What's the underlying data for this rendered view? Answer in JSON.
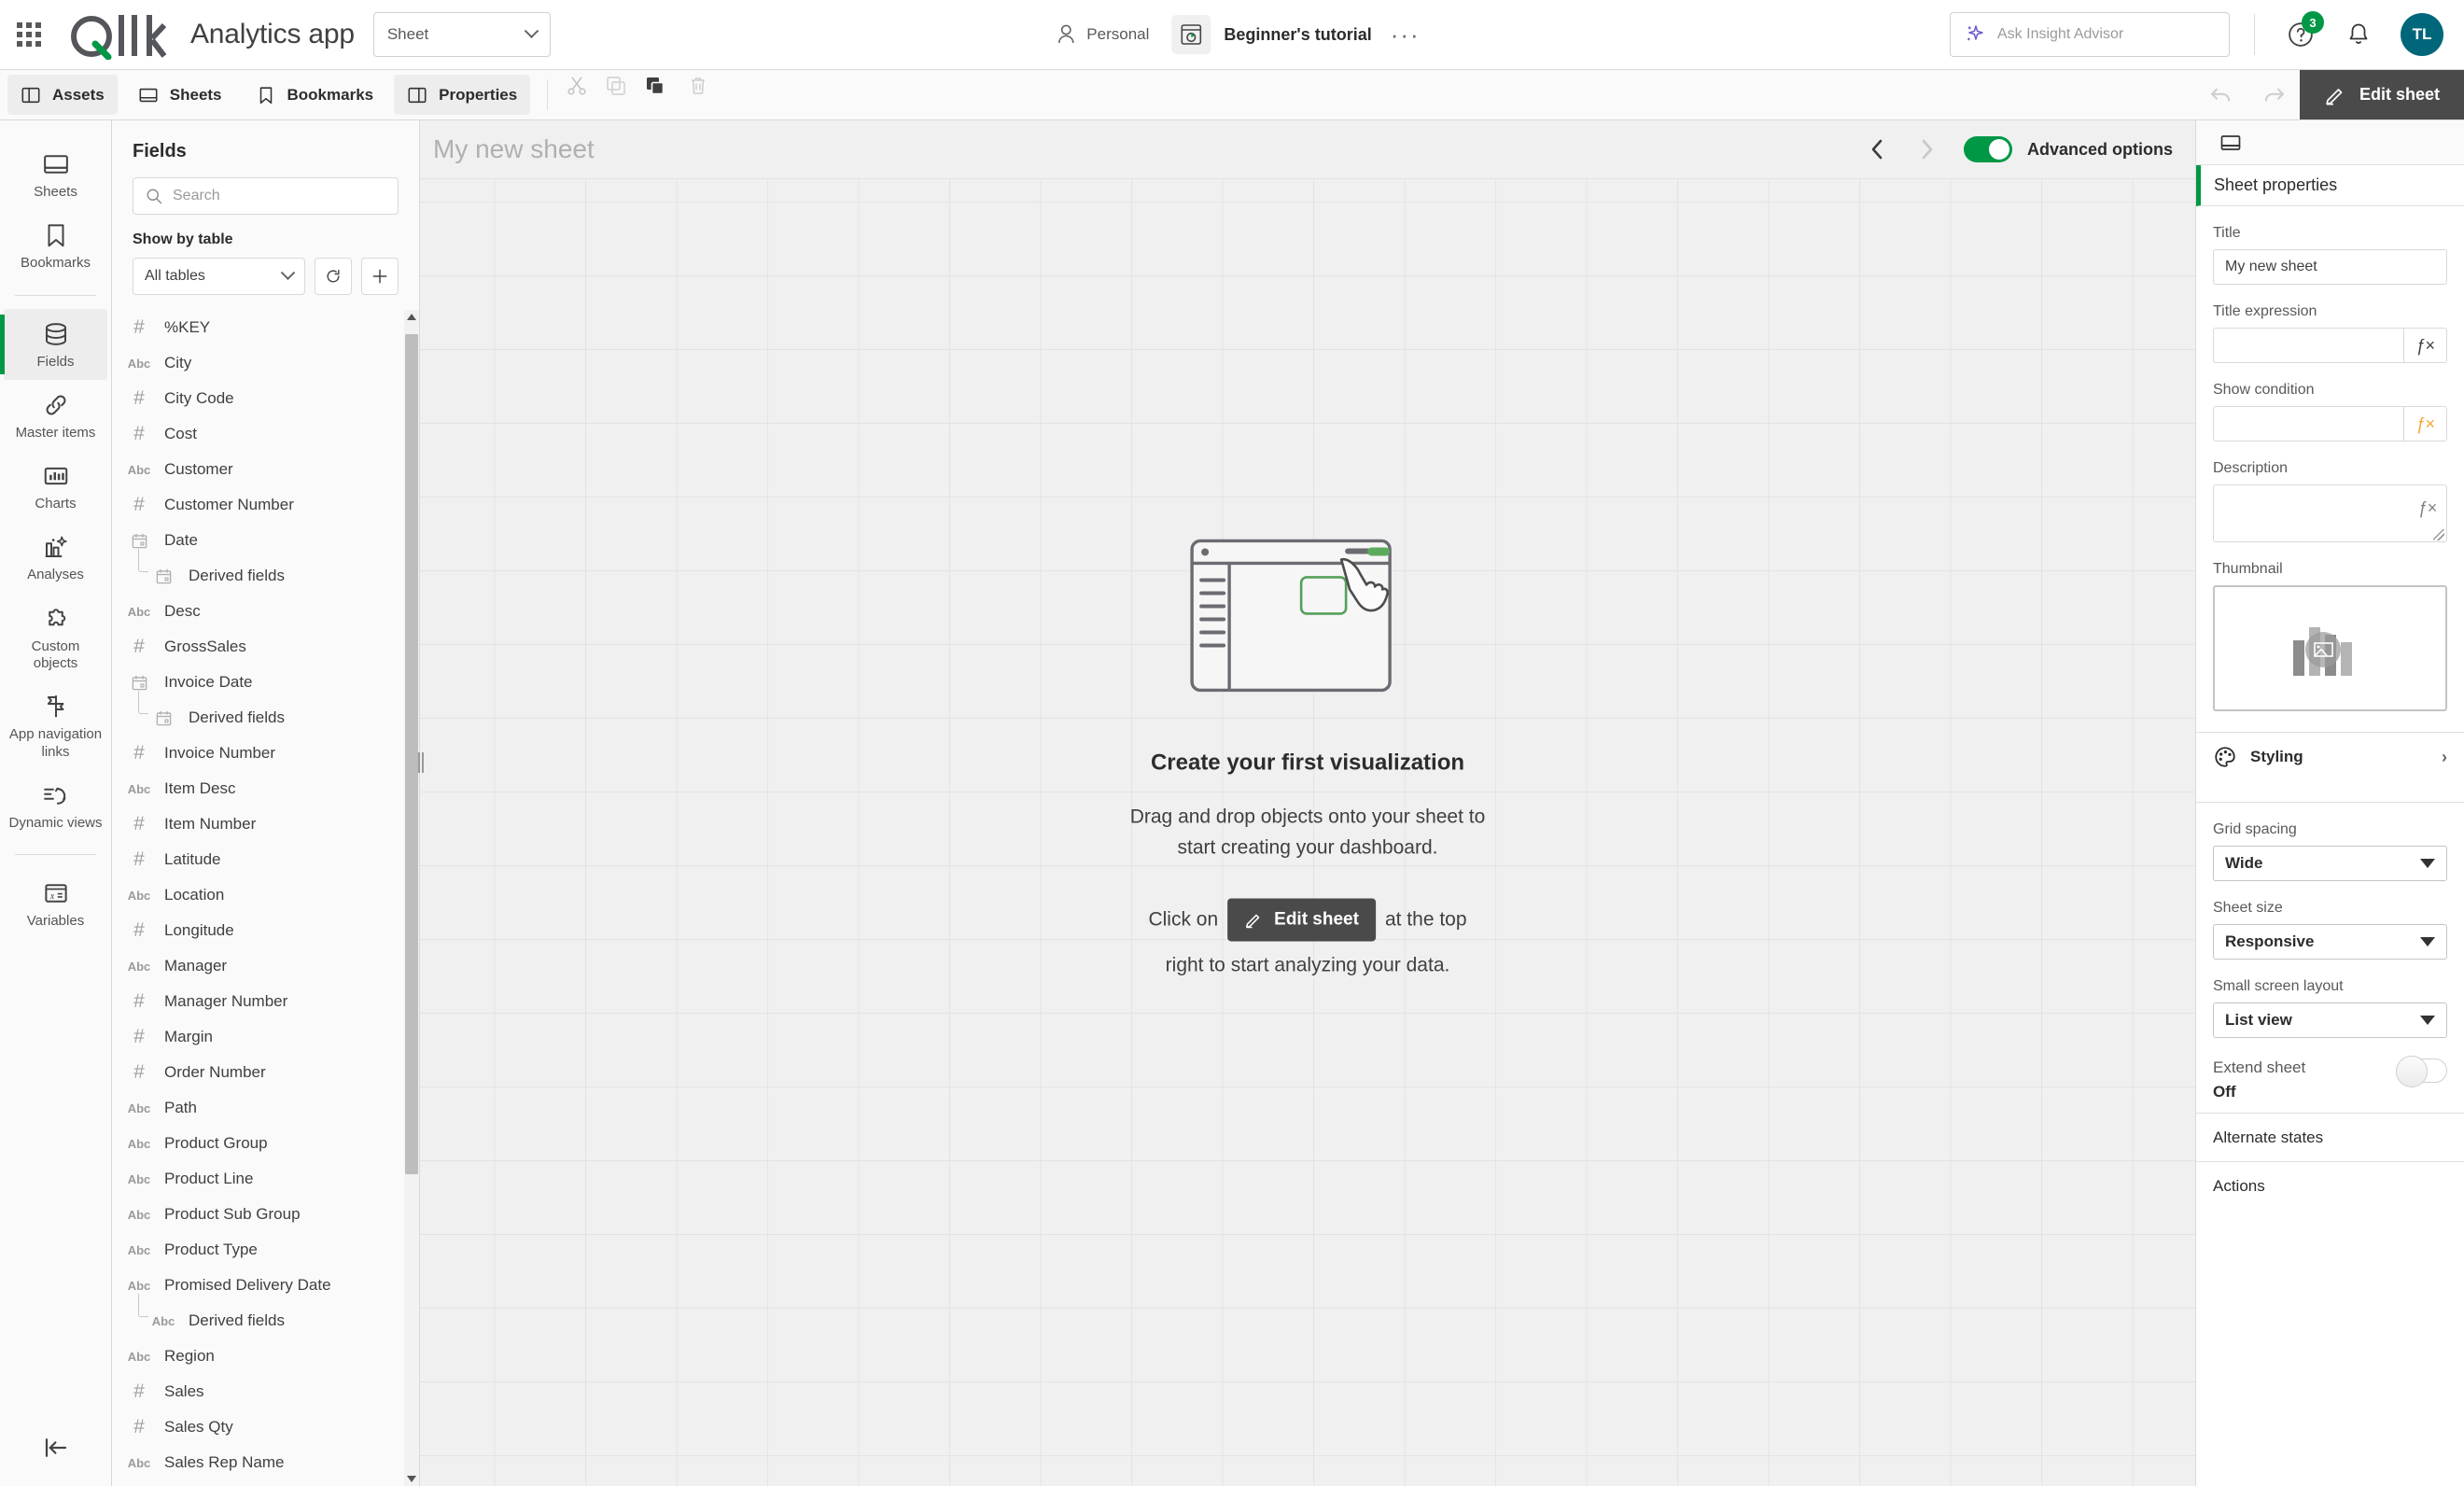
{
  "header": {
    "brand": "Qlik",
    "app_title": "Analytics app",
    "sheet_selector": "Sheet",
    "space_label": "Personal",
    "app_name": "Beginner's tutorial",
    "more_dots": "···",
    "insight_placeholder": "Ask Insight Advisor",
    "help_badge": "3",
    "avatar_initials": "TL"
  },
  "toolbar": {
    "assets": "Assets",
    "sheets": "Sheets",
    "bookmarks": "Bookmarks",
    "properties": "Properties",
    "edit_sheet": "Edit sheet"
  },
  "rail": {
    "items": [
      {
        "label": "Sheets",
        "icon": "sheet-icon",
        "active": false
      },
      {
        "label": "Bookmarks",
        "icon": "bookmark-icon",
        "active": false
      },
      {
        "label": "Fields",
        "icon": "database-icon",
        "active": true
      },
      {
        "label": "Master items",
        "icon": "link-icon",
        "active": false
      },
      {
        "label": "Charts",
        "icon": "bar-chart-icon",
        "active": false
      },
      {
        "label": "Analyses",
        "icon": "analyses-icon",
        "active": false
      },
      {
        "label": "Custom objects",
        "icon": "puzzle-icon",
        "active": false
      },
      {
        "label": "App navigation links",
        "icon": "flag-icon",
        "active": false
      },
      {
        "label": "Dynamic views",
        "icon": "dynamic-views-icon",
        "active": false
      },
      {
        "label": "Variables",
        "icon": "variable-icon",
        "active": false
      }
    ],
    "collapse_icon": "collapse-panel-icon"
  },
  "fields_panel": {
    "title": "Fields",
    "search_placeholder": "Search",
    "show_by_table_label": "Show by table",
    "table_filter_value": "All tables",
    "refresh_icon": "refresh-icon",
    "add_icon": "plus-icon",
    "items": [
      {
        "name": "%KEY",
        "type": "#",
        "child": false
      },
      {
        "name": "City",
        "type": "Abc",
        "child": false
      },
      {
        "name": "City Code",
        "type": "#",
        "child": false
      },
      {
        "name": "Cost",
        "type": "#",
        "child": false
      },
      {
        "name": "Customer",
        "type": "Abc",
        "child": false
      },
      {
        "name": "Customer Number",
        "type": "#",
        "child": false
      },
      {
        "name": "Date",
        "type": "cal",
        "child": false
      },
      {
        "name": "Derived fields",
        "type": "cal",
        "child": true
      },
      {
        "name": "Desc",
        "type": "Abc",
        "child": false
      },
      {
        "name": "GrossSales",
        "type": "#",
        "child": false
      },
      {
        "name": "Invoice Date",
        "type": "cal",
        "child": false
      },
      {
        "name": "Derived fields",
        "type": "cal",
        "child": true
      },
      {
        "name": "Invoice Number",
        "type": "#",
        "child": false
      },
      {
        "name": "Item Desc",
        "type": "Abc",
        "child": false
      },
      {
        "name": "Item Number",
        "type": "#",
        "child": false
      },
      {
        "name": "Latitude",
        "type": "#",
        "child": false
      },
      {
        "name": "Location",
        "type": "Abc",
        "child": false
      },
      {
        "name": "Longitude",
        "type": "#",
        "child": false
      },
      {
        "name": "Manager",
        "type": "Abc",
        "child": false
      },
      {
        "name": "Manager Number",
        "type": "#",
        "child": false
      },
      {
        "name": "Margin",
        "type": "#",
        "child": false
      },
      {
        "name": "Order Number",
        "type": "#",
        "child": false
      },
      {
        "name": "Path",
        "type": "Abc",
        "child": false
      },
      {
        "name": "Product Group",
        "type": "Abc",
        "child": false
      },
      {
        "name": "Product Line",
        "type": "Abc",
        "child": false
      },
      {
        "name": "Product Sub Group",
        "type": "Abc",
        "child": false
      },
      {
        "name": "Product Type",
        "type": "Abc",
        "child": false
      },
      {
        "name": "Promised Delivery Date",
        "type": "Abc",
        "child": false
      },
      {
        "name": "Derived fields",
        "type": "Abc",
        "child": true
      },
      {
        "name": "Region",
        "type": "Abc",
        "child": false
      },
      {
        "name": "Sales",
        "type": "#",
        "child": false
      },
      {
        "name": "Sales Qty",
        "type": "#",
        "child": false
      },
      {
        "name": "Sales Rep Name",
        "type": "Abc",
        "child": false
      }
    ]
  },
  "sheet": {
    "name": "My new sheet",
    "advanced_options_label": "Advanced options",
    "advanced_options_on": true,
    "empty_state": {
      "title": "Create your first visualization",
      "line1": "Drag and drop objects onto your sheet to",
      "line2": "start creating your dashboard.",
      "cta_prefix": "Click on",
      "cta_button": "Edit sheet",
      "cta_suffix": "at the top",
      "cta_line2": "right to start analyzing your data."
    }
  },
  "properties": {
    "tab_icon": "sheet-icon",
    "header": "Sheet properties",
    "title_label": "Title",
    "title_value": "My new sheet",
    "title_expression_label": "Title expression",
    "title_expression_value": "",
    "show_condition_label": "Show condition",
    "show_condition_value": "",
    "description_label": "Description",
    "description_value": "",
    "thumbnail_label": "Thumbnail",
    "styling_label": "Styling",
    "grid_spacing_label": "Grid spacing",
    "grid_spacing_value": "Wide",
    "sheet_size_label": "Sheet size",
    "sheet_size_value": "Responsive",
    "small_screen_label": "Small screen layout",
    "small_screen_value": "List view",
    "extend_sheet_label": "Extend sheet",
    "extend_sheet_value": "Off",
    "alternate_states_label": "Alternate states",
    "actions_label": "Actions",
    "fx_symbol": "ƒ×"
  },
  "colors": {
    "qlik_green": "#009845",
    "accent_dark": "#4a4a4a",
    "avatar_bg": "#00667a",
    "fx_orange": "#f3a635"
  }
}
